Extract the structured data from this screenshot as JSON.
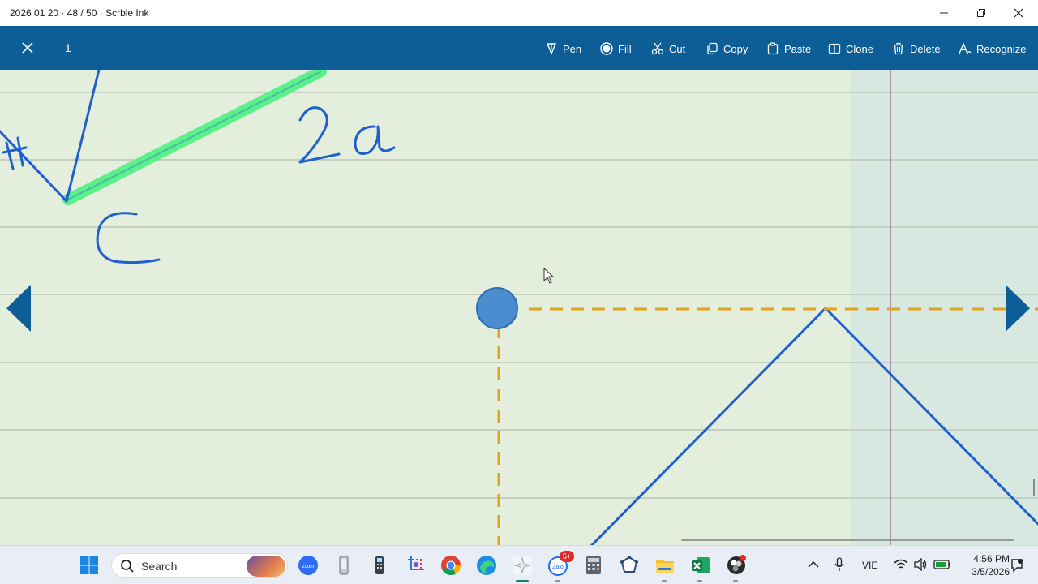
{
  "window": {
    "title": "2026 01 20 · 48 / 50 · Scrble Ink"
  },
  "toolbar": {
    "page_number": "1",
    "tools": [
      {
        "label": "Pen",
        "icon": "pen-icon"
      },
      {
        "label": "Fill",
        "icon": "fill-icon"
      },
      {
        "label": "Cut",
        "icon": "scissors-icon"
      },
      {
        "label": "Copy",
        "icon": "copy-icon"
      },
      {
        "label": "Paste",
        "icon": "paste-icon"
      },
      {
        "label": "Clone",
        "icon": "clone-icon"
      },
      {
        "label": "Delete",
        "icon": "trash-icon"
      },
      {
        "label": "Recognize",
        "icon": "recognize-icon"
      }
    ],
    "background_color": "#0d5e96"
  },
  "canvas": {
    "handwriting": [
      "2a",
      "C"
    ],
    "ink_color": "#1f5fd0",
    "highlight_color": "#5cf08a",
    "guide_color": "#e0a31c",
    "background_color": "#e4eedc"
  },
  "taskbar": {
    "search_placeholder": "Search",
    "language": "VIE",
    "time": "4:56 PM",
    "date": "3/5/2026",
    "zalo_badge": "5+",
    "apps": [
      "start-icon",
      "zoom-icon",
      "phone-link-icon",
      "calculator-mobile-icon",
      "snipping-tool-icon",
      "chrome-icon",
      "edge-icon",
      "scrble-ink-icon",
      "zalo-icon",
      "calculator-icon",
      "network-app-icon",
      "file-explorer-icon",
      "excel-icon",
      "obs-icon"
    ]
  }
}
